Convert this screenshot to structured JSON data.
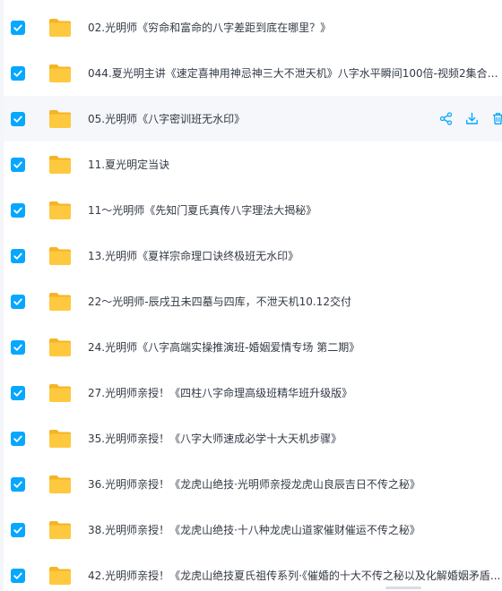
{
  "theme": {
    "checkbox_color": "#06a7ff",
    "folder_color": "#ffc93f",
    "folder_back_color": "#f5b425",
    "action_color": "#06a7ff",
    "text_color": "#333a45"
  },
  "icons": {
    "checkbox": "checkmark-icon",
    "folder": "folder-icon",
    "share": "share-icon",
    "download": "download-icon",
    "delete": "trash-icon"
  },
  "files": [
    {
      "name": "02.光明师《穷命和富命的八字差距到底在哪里？》",
      "checked": true
    },
    {
      "name": "044.夏光明主讲《速定喜神用神忌神三大不泄天机》八字水平瞬间100倍-视频2集合计...",
      "checked": true
    },
    {
      "name": "05.光明师《八字密训班无水印》",
      "checked": true,
      "hovered": true
    },
    {
      "name": "11.夏光明定当诀",
      "checked": true
    },
    {
      "name": "11～光明师《先知门夏氏真传八字理法大揭秘》",
      "checked": true
    },
    {
      "name": "13.光明师《夏祥宗命理口诀终极班无水印》",
      "checked": true
    },
    {
      "name": "22～光明师-辰戌丑未四墓与四库，不泄天机10.12交付",
      "checked": true
    },
    {
      "name": "24.光明师《八字高端实操推演班-婚姻爱情专场 第二期》",
      "checked": true
    },
    {
      "name": "27.光明师亲授！《四柱八字命理高级班精华班升级版》",
      "checked": true
    },
    {
      "name": "35.光明师亲授！《八字大师速成必学十大天机步骤》",
      "checked": true
    },
    {
      "name": "36.光明师亲授！《龙虎山绝技·光明师亲授龙虎山良辰吉日不传之秘》",
      "checked": true
    },
    {
      "name": "38.光明师亲授！《龙虎山绝技·十八种龙虎山道家催财催运不传之秘》",
      "checked": true
    },
    {
      "name": "42.光明师亲授！《龙虎山绝技夏氏祖传系列·《催婚的十大不传之秘以及化解婚姻矛盾...",
      "checked": true
    }
  ]
}
